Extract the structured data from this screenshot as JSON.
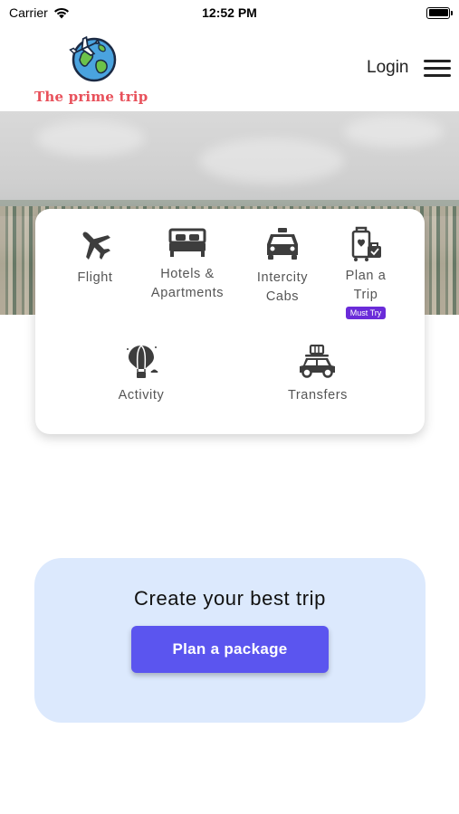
{
  "status_bar": {
    "carrier": "Carrier",
    "time": "12:52 PM"
  },
  "header": {
    "logo_text": "The prime trip",
    "login_label": "Login"
  },
  "services": [
    {
      "label": "Flight",
      "icon": "airplane-icon"
    },
    {
      "label": "Hotels &\nApartments",
      "icon": "bed-icon"
    },
    {
      "label": "Intercity\nCabs",
      "icon": "taxi-icon"
    },
    {
      "label": "Plan a\nTrip",
      "icon": "luggage-icon",
      "badge": "Must Try"
    },
    {
      "label": "Activity",
      "icon": "hot-air-balloon-icon"
    },
    {
      "label": "Transfers",
      "icon": "car-luggage-icon"
    }
  ],
  "cta": {
    "title": "Create your best trip",
    "button_label": "Plan a package"
  },
  "colors": {
    "brand": "#e8515b",
    "accent": "#5b55ef",
    "badge": "#6a2bd9",
    "cta_bg": "#dce9fd"
  }
}
